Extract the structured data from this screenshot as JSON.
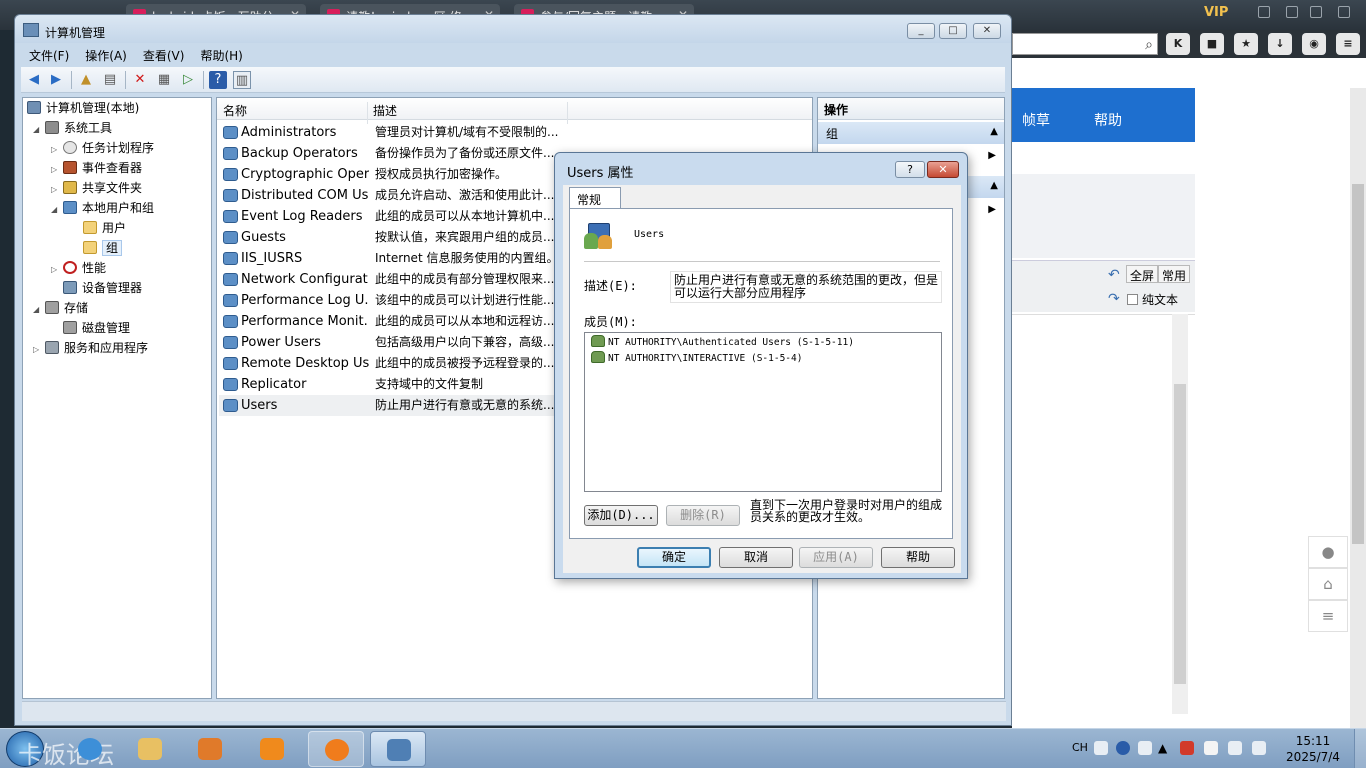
{
  "browser": {
    "tabs": [
      {
        "label": "luckcid, 卡饭 - 互助分"
      },
      {
        "label": "请教！windows区 修"
      },
      {
        "label": "参与/回复主题 - 请教"
      }
    ],
    "vip_label": "VIP",
    "nav": [
      "帧草",
      "帮助"
    ],
    "toolbar_buttons": [
      {
        "label": "全屏"
      },
      {
        "label": "常用"
      }
    ],
    "plain_text_label": "纯文本"
  },
  "mmc": {
    "title": "计算机管理",
    "menu": [
      "文件(F)",
      "操作(A)",
      "查看(V)",
      "帮助(H)"
    ],
    "tree": [
      {
        "label": "计算机管理(本地)",
        "icon": "computer-icon"
      },
      {
        "label": "系统工具",
        "icon": "tools-icon"
      },
      {
        "label": "任务计划程序",
        "icon": "clock-icon"
      },
      {
        "label": "事件查看器",
        "icon": "event-viewer-icon"
      },
      {
        "label": "共享文件夹",
        "icon": "shared-folder-icon"
      },
      {
        "label": "本地用户和组",
        "icon": "users-icon"
      },
      {
        "label": "用户",
        "icon": "folder-icon"
      },
      {
        "label": "组",
        "icon": "folder-icon"
      },
      {
        "label": "性能",
        "icon": "performance-icon"
      },
      {
        "label": "设备管理器",
        "icon": "device-manager-icon"
      },
      {
        "label": "存储",
        "icon": "storage-icon"
      },
      {
        "label": "磁盘管理",
        "icon": "disk-icon"
      },
      {
        "label": "服务和应用程序",
        "icon": "services-icon"
      }
    ],
    "list": {
      "columns": [
        "名称",
        "描述"
      ],
      "rows": [
        {
          "name": "Administrators",
          "desc": "管理员对计算机/域有不受限制的..."
        },
        {
          "name": "Backup Operators",
          "desc": "备份操作员为了备份或还原文件..."
        },
        {
          "name": "Cryptographic Oper...",
          "desc": "授权成员执行加密操作。"
        },
        {
          "name": "Distributed COM Us...",
          "desc": "成员允许启动、激活和使用此计..."
        },
        {
          "name": "Event Log Readers",
          "desc": "此组的成员可以从本地计算机中..."
        },
        {
          "name": "Guests",
          "desc": "按默认值，来宾跟用户组的成员..."
        },
        {
          "name": "IIS_IUSRS",
          "desc": "Internet 信息服务使用的内置组。"
        },
        {
          "name": "Network Configurat...",
          "desc": "此组中的成员有部分管理权限来..."
        },
        {
          "name": "Performance Log U...",
          "desc": "该组中的成员可以计划进行性能..."
        },
        {
          "name": "Performance Monit...",
          "desc": "此组的成员可以从本地和远程访..."
        },
        {
          "name": "Power Users",
          "desc": "包括高级用户以向下兼容，高级..."
        },
        {
          "name": "Remote Desktop Us...",
          "desc": "此组中的成员被授予远程登录的..."
        },
        {
          "name": "Replicator",
          "desc": "支持域中的文件复制"
        },
        {
          "name": "Users",
          "desc": "防止用户进行有意或无意的系统..."
        }
      ]
    },
    "actions": {
      "header": "操作",
      "group_label": "组"
    }
  },
  "dialog": {
    "title": "Users 属性",
    "tab": "常规",
    "group_name": "Users",
    "desc_label": "描述(E):",
    "desc_value": "防止用户进行有意或无意的系统范围的更改，但是可以运行大部分应用程序",
    "members_label": "成员(M):",
    "members": [
      "NT AUTHORITY\\Authenticated Users (S-1-5-11)",
      "NT AUTHORITY\\INTERACTIVE (S-1-5-4)"
    ],
    "add_label": "添加(D)...",
    "remove_label": "删除(R)",
    "note": "直到下一次用户登录时对用户的组成员关系的更改才生效。",
    "ok_label": "确定",
    "cancel_label": "取消",
    "apply_label": "应用(A)",
    "help_label": "帮助"
  },
  "taskbar": {
    "watermark": "卡饭论坛",
    "lang": "CH",
    "time": "15:11",
    "date": "2025/7/4"
  }
}
